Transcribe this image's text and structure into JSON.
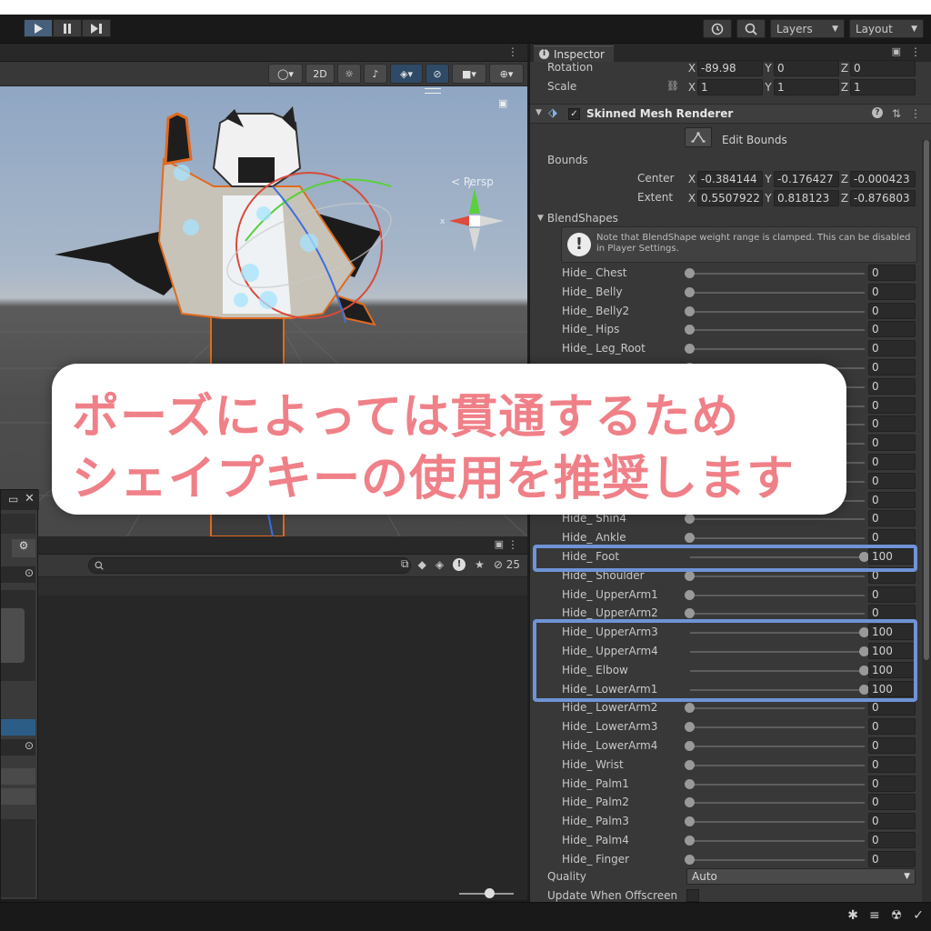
{
  "toolbar": {
    "layers_label": "Layers",
    "layout_label": "Layout"
  },
  "scene": {
    "mode_2d": "2D",
    "persp_label": "< Persp"
  },
  "project": {
    "hidden_count": "25"
  },
  "inspector": {
    "tab_label": "Inspector",
    "rotation": {
      "label": "Rotation",
      "x": "-89.98",
      "y": "0",
      "z": "0"
    },
    "scale": {
      "label": "Scale",
      "x": "1",
      "y": "1",
      "z": "1"
    },
    "component_title": "Skinned Mesh Renderer",
    "edit_bounds": "Edit Bounds",
    "bounds_label": "Bounds",
    "center": {
      "label": "Center",
      "x": "-0.384144",
      "y": "-0.176427",
      "z": "-0.000423"
    },
    "extent": {
      "label": "Extent",
      "x": "0.5507922",
      "y": "0.818123",
      "z": "-0.876803"
    },
    "blendshapes_label": "BlendShapes",
    "help_text": "Note that BlendShape weight range is clamped. This can be disabled in Player Settings.",
    "blendshapes": [
      {
        "name": "Hide_ Chest",
        "value": "0"
      },
      {
        "name": "Hide_ Belly",
        "value": "0"
      },
      {
        "name": "Hide_ Belly2",
        "value": "0"
      },
      {
        "name": "Hide_ Hips",
        "value": "0"
      },
      {
        "name": "Hide_ Leg_Root",
        "value": "0"
      },
      {
        "name": "",
        "value": "0"
      },
      {
        "name": "",
        "value": "0"
      },
      {
        "name": "",
        "value": "0"
      },
      {
        "name": "",
        "value": "0"
      },
      {
        "name": "",
        "value": "0"
      },
      {
        "name": "",
        "value": "0"
      },
      {
        "name": "",
        "value": "0"
      },
      {
        "name": "",
        "value": "0"
      },
      {
        "name": "Hide_ Shin4",
        "value": "0"
      },
      {
        "name": "Hide_ Ankle",
        "value": "0"
      },
      {
        "name": "Hide_ Foot",
        "value": "100"
      },
      {
        "name": "Hide_ Shoulder",
        "value": "0"
      },
      {
        "name": "Hide_ UpperArm1",
        "value": "0"
      },
      {
        "name": "Hide_ UpperArm2",
        "value": "0"
      },
      {
        "name": "Hide_ UpperArm3",
        "value": "100"
      },
      {
        "name": "Hide_ UpperArm4",
        "value": "100"
      },
      {
        "name": "Hide_ Elbow",
        "value": "100"
      },
      {
        "name": "Hide_ LowerArm1",
        "value": "100"
      },
      {
        "name": "Hide_ LowerArm2",
        "value": "0"
      },
      {
        "name": "Hide_ LowerArm3",
        "value": "0"
      },
      {
        "name": "Hide_ LowerArm4",
        "value": "0"
      },
      {
        "name": "Hide_ Wrist",
        "value": "0"
      },
      {
        "name": "Hide_ Palm1",
        "value": "0"
      },
      {
        "name": "Hide_ Palm2",
        "value": "0"
      },
      {
        "name": "Hide_ Palm3",
        "value": "0"
      },
      {
        "name": "Hide_ Palm4",
        "value": "0"
      },
      {
        "name": "Hide_ Finger",
        "value": "0"
      }
    ],
    "quality_label": "Quality",
    "quality_value": "Auto",
    "update_offscreen_label": "Update When Offscreen"
  },
  "caption": {
    "line1": "ポーズによっては貫通するため",
    "line2": "シェイプキーの使用を推奨します"
  },
  "colors": {
    "highlight": "#6f93d6",
    "caption_text": "#f08088",
    "play_active": "#46607c"
  }
}
